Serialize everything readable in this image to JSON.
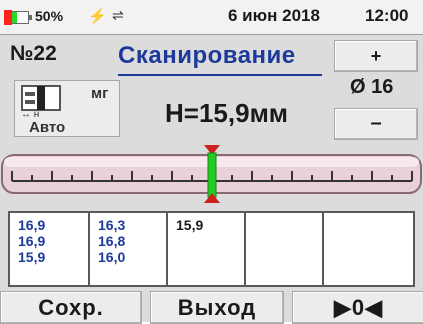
{
  "status": {
    "battery_percent_text": "50%",
    "battery_level": 0.5,
    "charge_icon": "lightning-icon",
    "usb_icon": "usb-icon",
    "date": "6 июн 2018",
    "time": "12:00"
  },
  "header": {
    "number": "№22",
    "mode_title": "Сканирование"
  },
  "controls": {
    "plus_label": "+",
    "minus_label": "–",
    "diameter": "Ø 16"
  },
  "probe": {
    "unit": "мг",
    "arrow_note": "↔ н",
    "mode": "Авто"
  },
  "reading": {
    "depth": "H=15,9мм"
  },
  "scale": {
    "marker_level": 0.5
  },
  "readings_table": {
    "columns": [
      {
        "values": [
          "16,9",
          "16,9",
          "15,9"
        ],
        "color": "#1d3a9a"
      },
      {
        "values": [
          "16,3",
          "16,8",
          "16,0"
        ],
        "color": "#1d3a9a"
      },
      {
        "values": [
          "15,9"
        ],
        "color": "#1a1a1a"
      },
      {
        "values": []
      },
      {
        "values": []
      }
    ]
  },
  "footer": {
    "save_label": "Сохр.",
    "exit_label": "Выход",
    "zero_label": "▶0◀"
  },
  "colors": {
    "accent_blue": "#1d3a9a",
    "battery_green": "#22dd22",
    "marker_green": "#22cc22",
    "marker_red": "#cc2222",
    "scale_pink": "#e8c8d0"
  }
}
